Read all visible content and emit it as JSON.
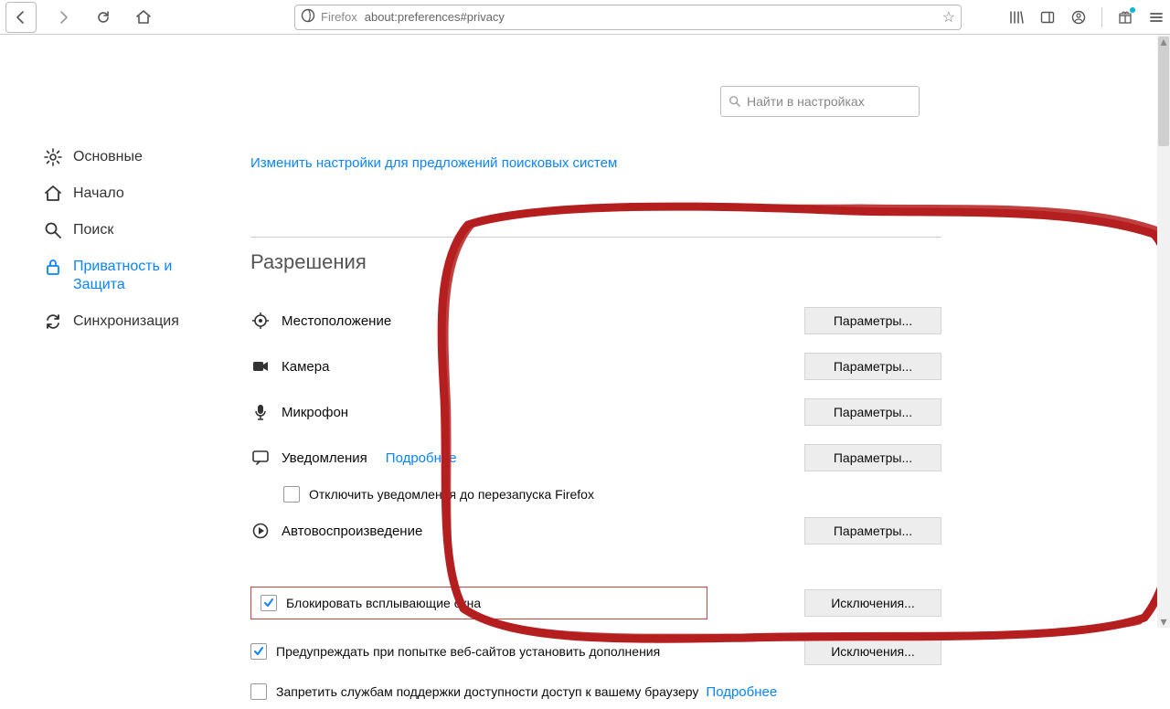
{
  "toolbar": {
    "firefox_label": "Firefox",
    "url": "about:preferences#privacy"
  },
  "search": {
    "placeholder": "Найти в настройках"
  },
  "top_link": "Изменить настройки для предложений поисковых систем",
  "sidebar": {
    "items": [
      {
        "label": "Основные"
      },
      {
        "label": "Начало"
      },
      {
        "label": "Поиск"
      },
      {
        "label": "Приватность и Защита"
      },
      {
        "label": "Синхронизация"
      }
    ]
  },
  "section": {
    "title": "Разрешения",
    "location": {
      "label": "Местоположение",
      "button": "Параметры..."
    },
    "camera": {
      "label": "Камера",
      "button": "Параметры..."
    },
    "microphone": {
      "label": "Микрофон",
      "button": "Параметры..."
    },
    "notifications": {
      "label": "Уведомления",
      "more": "Подробнее",
      "button": "Параметры...",
      "disable_until_restart": "Отключить уведомления до перезапуска Firefox"
    },
    "autoplay": {
      "label": "Автовоспроизведение",
      "button": "Параметры..."
    },
    "block_popups": {
      "label": "Блокировать всплывающие окна",
      "button": "Исключения..."
    },
    "warn_addons": {
      "label": "Предупреждать при попытке веб-сайтов установить дополнения",
      "button": "Исключения..."
    },
    "accessibility": {
      "label": "Запретить службам поддержки доступности доступ к вашему браузеру",
      "more": "Подробнее"
    }
  }
}
